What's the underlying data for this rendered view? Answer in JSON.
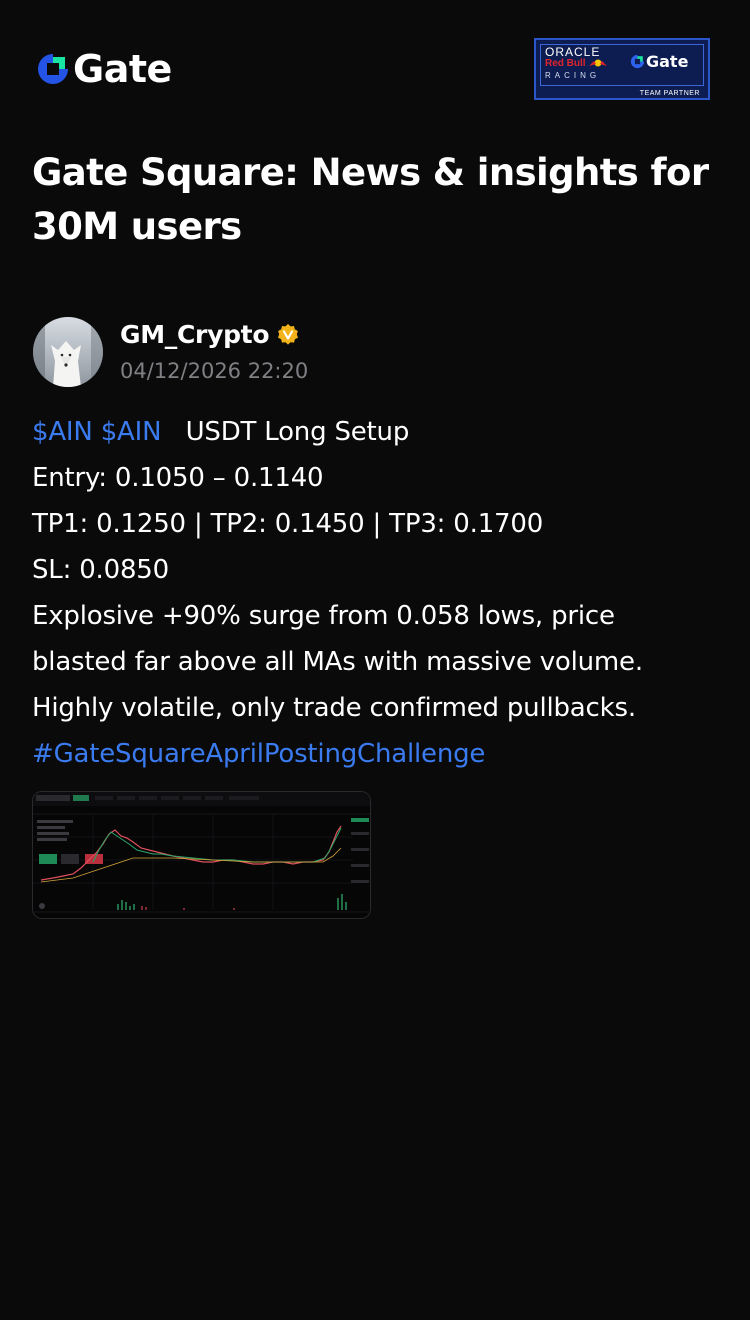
{
  "brand": {
    "name": "Gate",
    "accent": "#2354e6",
    "accent_green": "#17e5a1"
  },
  "partner_badge": {
    "line1": "ORACLE",
    "line2": "Red Bull",
    "line3": "RACING",
    "gate": "Gate",
    "caption": "TEAM PARTNER"
  },
  "page": {
    "title": "Gate Square: News & insights for 30M users"
  },
  "post": {
    "author": "GM_Crypto",
    "timestamp": "04/12/2026 22:20",
    "cashtags": "$AIN $AIN",
    "headline": "USDT Long Setup",
    "entry": "Entry: 0.1050 – 0.1140",
    "targets": "TP1: 0.1250 | TP2: 0.1450 | TP3: 0.1700",
    "stop": "SL: 0.0850",
    "desc1": "Explosive +90% surge from 0.058 lows, price",
    "desc2": "blasted far above all MAs with massive volume.",
    "desc3": "Highly volatile, only trade confirmed pullbacks.",
    "hashtag": "#GateSquareAprilPostingChallenge",
    "link_color": "#3b7bf0"
  },
  "chart_thumb": {
    "symbol": "AINUSDT Perp",
    "price": "0.11124",
    "long_label": "Buy/Long",
    "short_label": "Sell/Short"
  }
}
